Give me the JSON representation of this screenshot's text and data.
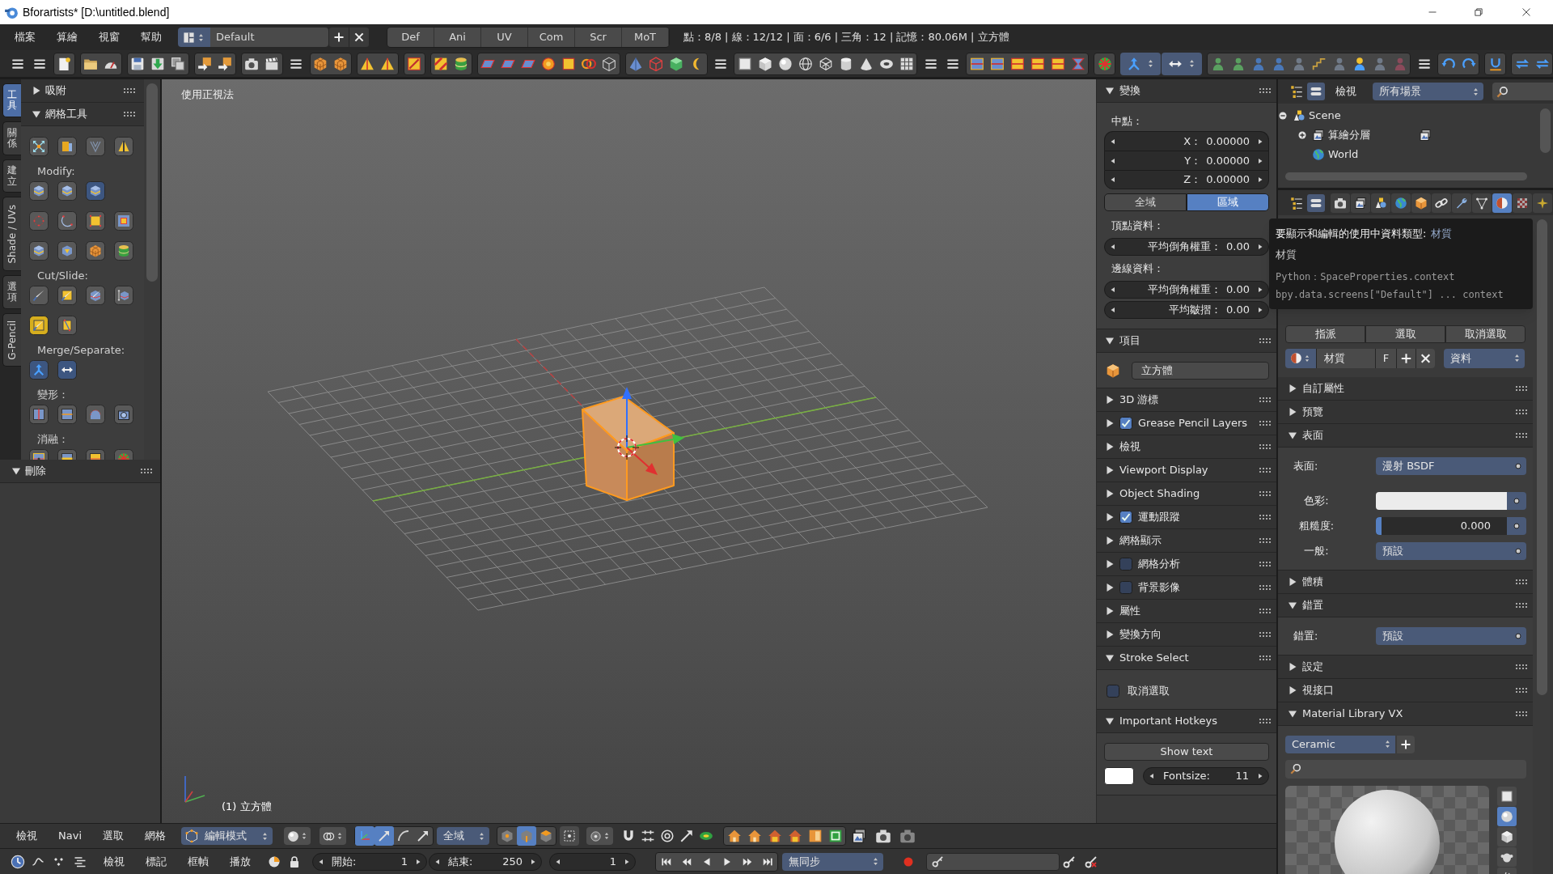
{
  "window": {
    "title": "Bforartists* [D:\\untitled.blend]"
  },
  "menu_bar": {
    "menus": [
      "檔案",
      "算繪",
      "視窗",
      "幫助"
    ],
    "screen_layout": "Default",
    "workspace_tabs": [
      {
        "label": "Def",
        "selected": false
      },
      {
        "label": "Ani",
        "selected": false
      },
      {
        "label": "UV",
        "selected": false
      },
      {
        "label": "Com",
        "selected": false
      },
      {
        "label": "Scr",
        "selected": false
      },
      {
        "label": "MoT",
        "selected": false
      }
    ],
    "stats": "點：8/8 | 線：12/12 | 面：6/6 | 三角：12 | 記憶：80.06M | 立方體"
  },
  "tool_shelf": {
    "tabs": [
      {
        "label": "工具",
        "selected": true
      },
      {
        "label": "關係",
        "selected": false
      },
      {
        "label": "建立",
        "selected": false
      },
      {
        "label": "Shade / UVs",
        "selected": false
      },
      {
        "label": "選項",
        "selected": false
      },
      {
        "label": "G-Pencil",
        "selected": false
      }
    ],
    "panels": [
      {
        "title": "吸附",
        "expanded": false
      },
      {
        "title": "網格工具",
        "expanded": true,
        "sections": [
          {
            "label": "Modify:"
          },
          {
            "label": "Cut/Slide:"
          },
          {
            "label": "Merge/Separate:"
          },
          {
            "label": "變形："
          },
          {
            "label": "消融："
          }
        ]
      }
    ],
    "footer_panel": {
      "title": "刪除",
      "expanded": true
    }
  },
  "viewport": {
    "view_label": "使用正視法",
    "object_label": "(1) 立方體"
  },
  "sidebar": {
    "panels": [
      {
        "kind": "transform",
        "title": "變換",
        "expanded": true,
        "median_label": "中點：",
        "median": [
          {
            "label": "X：",
            "value": "0.00000"
          },
          {
            "label": "Y：",
            "value": "0.00000"
          },
          {
            "label": "Z：",
            "value": "0.00000"
          }
        ],
        "spaces": [
          {
            "label": "全域",
            "selected": false
          },
          {
            "label": "區域",
            "selected": true
          }
        ],
        "vertex_label": "頂點資料：",
        "vertex_fields": [
          {
            "label": "平均倒角權重：",
            "value": "0.00"
          }
        ],
        "edge_label": "邊線資料：",
        "edge_fields": [
          {
            "label": "平均倒角權重：",
            "value": "0.00"
          },
          {
            "label": "平均皺摺：",
            "value": "0.00"
          }
        ]
      },
      {
        "kind": "item",
        "title": "項目",
        "expanded": true,
        "name": "立方體"
      },
      {
        "kind": "plain",
        "title": "3D 游標",
        "expanded": false
      },
      {
        "kind": "toggle",
        "title": "Grease Pencil Layers",
        "expanded": false,
        "checked": true
      },
      {
        "kind": "plain",
        "title": "檢視",
        "expanded": false
      },
      {
        "kind": "plain",
        "title": "Viewport Display",
        "expanded": false
      },
      {
        "kind": "plain",
        "title": "Object Shading",
        "expanded": false
      },
      {
        "kind": "toggle",
        "title": "運動跟蹤",
        "expanded": false,
        "checked": true
      },
      {
        "kind": "plain",
        "title": "網格顯示",
        "expanded": false
      },
      {
        "kind": "toggle",
        "title": "網格分析",
        "expanded": false,
        "checked": false
      },
      {
        "kind": "toggle",
        "title": "背景影像",
        "expanded": false,
        "checked": false
      },
      {
        "kind": "plain",
        "title": "屬性",
        "expanded": false
      },
      {
        "kind": "plain",
        "title": "變換方向",
        "expanded": false
      },
      {
        "kind": "stroke_select",
        "title": "Stroke Select",
        "expanded": true,
        "option": {
          "label": "取消選取",
          "checked": false
        }
      },
      {
        "kind": "hotkeys",
        "title": "Important Hotkeys",
        "expanded": true,
        "button": "Show text",
        "fontsize_label": "Fontsize:",
        "fontsize": "11"
      }
    ]
  },
  "outliner": {
    "view_menu": "檢視",
    "scene_filter": "所有場景",
    "tree": [
      {
        "label": "Scene",
        "expanded": true,
        "children": [
          {
            "label": "算繪分層",
            "expanded": false
          },
          {
            "label": "World"
          }
        ]
      }
    ]
  },
  "properties": {
    "tabs": [
      {
        "selected": false
      },
      {
        "selected": false
      },
      {
        "selected": false
      },
      {
        "selected": false
      },
      {
        "selected": false
      },
      {
        "selected": false
      },
      {
        "selected": false
      },
      {
        "selected": false
      },
      {
        "selected": true
      },
      {
        "selected": false
      },
      {
        "selected": false
      }
    ],
    "tooltip": {
      "title": "要顯示和編輯的使用中資料類型:",
      "value": "材質",
      "description": "材質",
      "python": "Python：SpaceProperties.context",
      "path": "bpy.data.screens[\"Default\"] ... context"
    },
    "slot_buttons": [
      "指派",
      "選取",
      "取消選取"
    ],
    "slot": {
      "name": "材質",
      "fake_user": "F",
      "link": "資料"
    },
    "panels": [
      {
        "kind": "fields",
        "title": "自訂屬性",
        "expanded": false
      },
      {
        "kind": "fields",
        "title": "預覽",
        "expanded": false
      },
      {
        "kind": "fields",
        "title": "表面",
        "expanded": true,
        "rows": [
          {
            "kind": "link",
            "label": "表面:",
            "value": "漫射 BSDF"
          },
          {
            "kind": "color",
            "label": "色彩:"
          },
          {
            "kind": "slider",
            "label": "粗糙度:",
            "value": "0.000",
            "level": 0
          },
          {
            "kind": "menu",
            "label": "一般:",
            "value": "預設"
          }
        ]
      },
      {
        "kind": "fields",
        "title": "體積",
        "expanded": false
      },
      {
        "kind": "fields",
        "title": "錯置",
        "expanded": true,
        "rows": [
          {
            "kind": "link",
            "label": "錯置:",
            "value": "預設"
          }
        ]
      },
      {
        "kind": "fields",
        "title": "設定",
        "expanded": false
      },
      {
        "kind": "fields",
        "title": "視接口",
        "expanded": false
      },
      {
        "kind": "library",
        "title": "Material Library VX",
        "expanded": true,
        "library": "Ceramic",
        "preview_shapes": [
          {
            "selected": false
          },
          {
            "selected": true
          },
          {
            "selected": false
          },
          {
            "selected": false
          },
          {
            "selected": false
          }
        ]
      }
    ]
  },
  "view3d_header": {
    "menus": [
      "檢視",
      "Navi",
      "選取",
      "網格"
    ],
    "mode": "編輯模式",
    "manipulators": [
      {
        "selected": true
      },
      {
        "selected": true
      },
      {
        "selected": false
      },
      {
        "selected": false
      }
    ],
    "orientation": "全域",
    "select_modes": [
      {
        "selected": false
      },
      {
        "selected": true
      },
      {
        "selected": false
      }
    ]
  },
  "timeline": {
    "menus": [
      "檢視",
      "標記",
      "框幀",
      "播放"
    ],
    "start": {
      "label": "開始:",
      "value": "1"
    },
    "end": {
      "label": "結束:",
      "value": "250"
    },
    "current_frame": "1",
    "sync": "無同步"
  }
}
